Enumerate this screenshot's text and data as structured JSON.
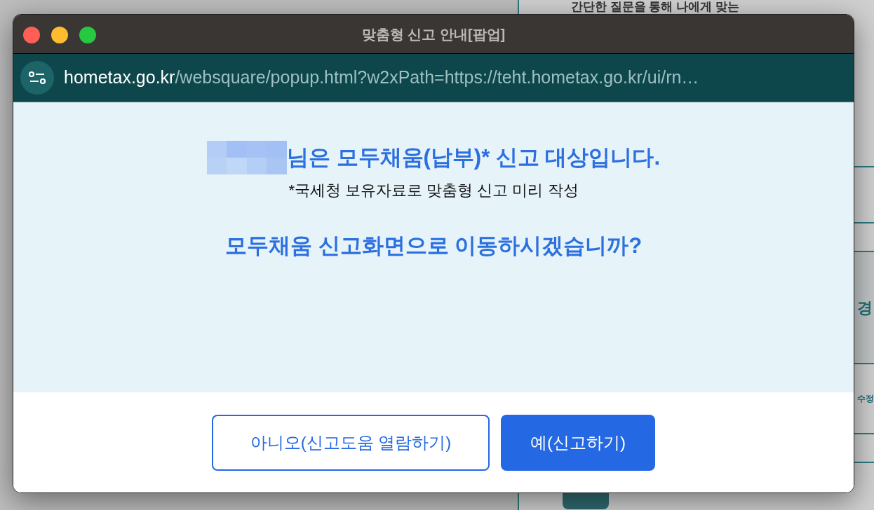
{
  "background_page": {
    "heading": "간단한 질문을 통해 나에게 맞는",
    "side_labels": [
      {
        "text": "경",
        "shaded": true
      },
      {
        "text": "수정",
        "shaded": false
      }
    ]
  },
  "popup": {
    "title": "맞춤형 신고 안내[팝업]",
    "url": {
      "domain": "hometax.go.kr",
      "path": "/websquare/popup.html?w2xPath=https://teht.hometax.go.kr/ui/rn…"
    },
    "headline": "님은 모두채움(납부)* 신고 대상입니다.",
    "note": "*국세청 보유자료로 맞춤형 신고 미리 작성",
    "question": "모두채움 신고화면으로 이동하시겠습니까?",
    "buttons": [
      {
        "label": "아니오(신고도움 열람하기)",
        "kind": "outline"
      },
      {
        "label": "예(신고하기)",
        "kind": "primary"
      }
    ]
  }
}
